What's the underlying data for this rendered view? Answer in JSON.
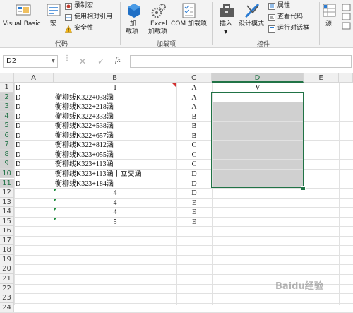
{
  "ribbon": {
    "visual_basic": "Visual Basic",
    "macros": "宏",
    "record_macro": "录制宏",
    "relative_refs": "使用相对引用",
    "macro_security": "安全性",
    "group_code": "代码",
    "addins_line1": "加",
    "addins_line2": "载项",
    "excel_addins_line1": "Excel",
    "excel_addins_line2": "加载项",
    "com_addins": "COM 加载项",
    "group_addins": "加载项",
    "insert": "插入",
    "design_mode": "设计模式",
    "properties": "属性",
    "view_code": "查看代码",
    "run_dialog": "运行对话框",
    "group_controls": "控件",
    "source": "源"
  },
  "formula_bar": {
    "name_box": "D2",
    "fx": "fx",
    "content": ""
  },
  "columns": [
    "A",
    "B",
    "C",
    "D",
    "E"
  ],
  "rows": [
    {
      "n": "1",
      "a": "D",
      "b": "1",
      "c": "A",
      "d": "V"
    },
    {
      "n": "2",
      "a": "D",
      "b": "衡柳线K322+038涵",
      "c": "A",
      "d": ""
    },
    {
      "n": "3",
      "a": "D",
      "b": "衡柳线K322+218涵",
      "c": "A",
      "d": ""
    },
    {
      "n": "4",
      "a": "D",
      "b": "衡柳线K322+333涵",
      "c": "B",
      "d": ""
    },
    {
      "n": "5",
      "a": "D",
      "b": "衡柳线K322+538涵",
      "c": "B",
      "d": ""
    },
    {
      "n": "6",
      "a": "D",
      "b": "衡柳线K322+657涵",
      "c": "B",
      "d": ""
    },
    {
      "n": "7",
      "a": "D",
      "b": "衡柳线K322+812涵",
      "c": "C",
      "d": ""
    },
    {
      "n": "8",
      "a": "D",
      "b": "衡柳线K323+055涵",
      "c": "C",
      "d": ""
    },
    {
      "n": "9",
      "a": "D",
      "b": "衡柳线K323+113涵",
      "c": "C",
      "d": ""
    },
    {
      "n": "10",
      "a": "D",
      "b": "衡柳线K323+113涵丨立交涵",
      "c": "D",
      "d": ""
    },
    {
      "n": "11",
      "a": "D",
      "b": "衡柳线K323+184涵",
      "c": "D",
      "d": ""
    },
    {
      "n": "12",
      "a": "",
      "b": "4",
      "c": "D",
      "d": ""
    },
    {
      "n": "13",
      "a": "",
      "b": "4",
      "c": "E",
      "d": ""
    },
    {
      "n": "14",
      "a": "",
      "b": "4",
      "c": "E",
      "d": ""
    },
    {
      "n": "15",
      "a": "",
      "b": "5",
      "c": "E",
      "d": ""
    },
    {
      "n": "16",
      "a": "",
      "b": "",
      "c": "",
      "d": ""
    },
    {
      "n": "17",
      "a": "",
      "b": "",
      "c": "",
      "d": ""
    },
    {
      "n": "18",
      "a": "",
      "b": "",
      "c": "",
      "d": ""
    },
    {
      "n": "19",
      "a": "",
      "b": "",
      "c": "",
      "d": ""
    },
    {
      "n": "20",
      "a": "",
      "b": "",
      "c": "",
      "d": ""
    },
    {
      "n": "21",
      "a": "",
      "b": "",
      "c": "",
      "d": ""
    },
    {
      "n": "22",
      "a": "",
      "b": "",
      "c": "",
      "d": ""
    },
    {
      "n": "23",
      "a": "",
      "b": "",
      "c": "",
      "d": ""
    },
    {
      "n": "24",
      "a": "",
      "b": "",
      "c": "",
      "d": ""
    }
  ],
  "watermark": "Baidu经验"
}
